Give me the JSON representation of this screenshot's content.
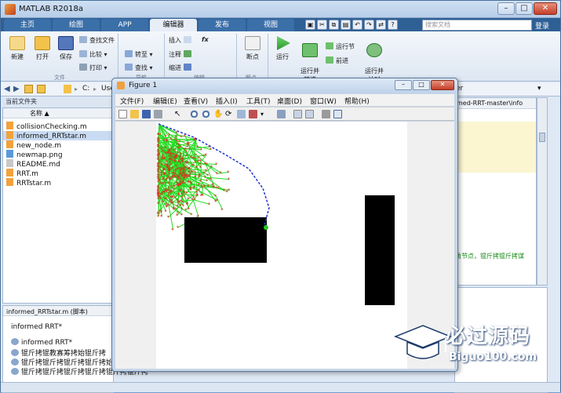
{
  "app": {
    "title": "MATLAB R2018a"
  },
  "tabs": [
    {
      "label": "主页"
    },
    {
      "label": "绘图"
    },
    {
      "label": "APP"
    },
    {
      "label": "编辑器"
    },
    {
      "label": "发布"
    },
    {
      "label": "视图"
    }
  ],
  "search": {
    "placeholder": "搜索文档"
  },
  "login_label": "登录",
  "ribbon": {
    "new": "新建",
    "open": "打开",
    "save": "保存",
    "find_files": "查找文件",
    "compare": "比较",
    "print": "打印",
    "group_file": "文件",
    "goto": "转至",
    "find": "查找",
    "group_nav": "导航",
    "insert": "插入",
    "comment": "注释",
    "indent": "缩进",
    "fx": "fx",
    "group_edit": "编辑",
    "breakpoints": "断点",
    "group_bp": "断点",
    "run": "运行",
    "run_advance": "运行并\n前进",
    "run_section": "运行节",
    "advance": "前进",
    "run_time": "运行并\n计时"
  },
  "address": {
    "path_prefix": "C:",
    "path_mid": "Use",
    "path_right": "er"
  },
  "current_folder": {
    "header": "当前文件夹",
    "col_name": "名称 ▲",
    "files": [
      {
        "name": "collisionChecking.m",
        "type": "m"
      },
      {
        "name": "informed_RRTstar.m",
        "type": "m",
        "selected": true
      },
      {
        "name": "new_node.m",
        "type": "m"
      },
      {
        "name": "newmap.png",
        "type": "png"
      },
      {
        "name": "README.md",
        "type": "md"
      },
      {
        "name": "RRT.m",
        "type": "m"
      },
      {
        "name": "RRTstar.m",
        "type": "m"
      }
    ]
  },
  "details": {
    "title": "informed_RRTstar.m (脚本)",
    "heading": "informed RRT*",
    "items": [
      "informed RRT*",
      "锟斤拷锟教寡筹拷始锟斤拷",
      "锟斤拷锟斤拷锟斤拷锟斤拷始锟斤拷",
      "锟斤拷锟斤拷锟斤拷锟斤拷锟斤拷锟斤拷"
    ]
  },
  "editor_right": {
    "path_fragment": "med-RRT-master\\info",
    "code_fragment": "角节点，锟斤拷锟斤拷谋"
  },
  "figure": {
    "title": "Figure 1",
    "menu": [
      "文件(F)",
      "编辑(E)",
      "查看(V)",
      "插入(I)",
      "工具(T)",
      "桌面(D)",
      "窗口(W)",
      "帮助(H)"
    ]
  },
  "watermark": {
    "text": "必过源码",
    "url": "Biguo100.com"
  },
  "colors": {
    "tab_bar": "#2e5f95",
    "tree_edges": "#22dd22",
    "nodes": "#ee2222",
    "obstacles": "#000000",
    "path": "#2233cc"
  }
}
